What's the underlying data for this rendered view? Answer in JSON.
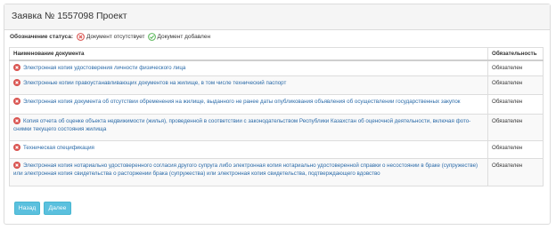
{
  "header": {
    "title": "Заявка № 1557098 Проект"
  },
  "legend": {
    "label": "Обозначение статуса:",
    "missing": "Документ отсутствует",
    "added": "Документ добавлен"
  },
  "table": {
    "col_name": "Наименование документа",
    "col_required": "Обязательность",
    "rows": [
      {
        "name": "Электронная копия удостоверения личности физического лица",
        "required": "Обязателен"
      },
      {
        "name": "Электронные копии правоустанавливающих документов на жилище, в том числе технический паспорт",
        "required": "Обязателен"
      },
      {
        "name": "Электронная копия документа об отсутствии обременения на жилище, выданного не ранее даты опубликования объявления об осуществлении государственных закупок",
        "required": "Обязателен"
      },
      {
        "name": "Копия отчета об оценке объекта недвижимости (жилья), проведенной в соответствии с законодательством Республики Казахстан об оценочной деятельности, включая фото-снимки текущего состояния жилища",
        "required": "Обязателен"
      },
      {
        "name": "Техническая спецификация",
        "required": "Обязателен"
      },
      {
        "name": "Электронная копия нотариально удостоверенного согласия другого супруга либо электронная копия нотариально удостоверенной справки о несостоянии в браке (супружестве) или электронная копия свидетельства о расторжении брака (супружества) или электронная копия свидетельства, подтверждающего вдовство",
        "required": "Обязателен"
      }
    ]
  },
  "buttons": {
    "back": "Назад",
    "next": "Далее"
  },
  "colors": {
    "missing": "#d9534f",
    "added": "#5cb85c",
    "link": "#2a6aa8",
    "button": "#5bc0de"
  }
}
